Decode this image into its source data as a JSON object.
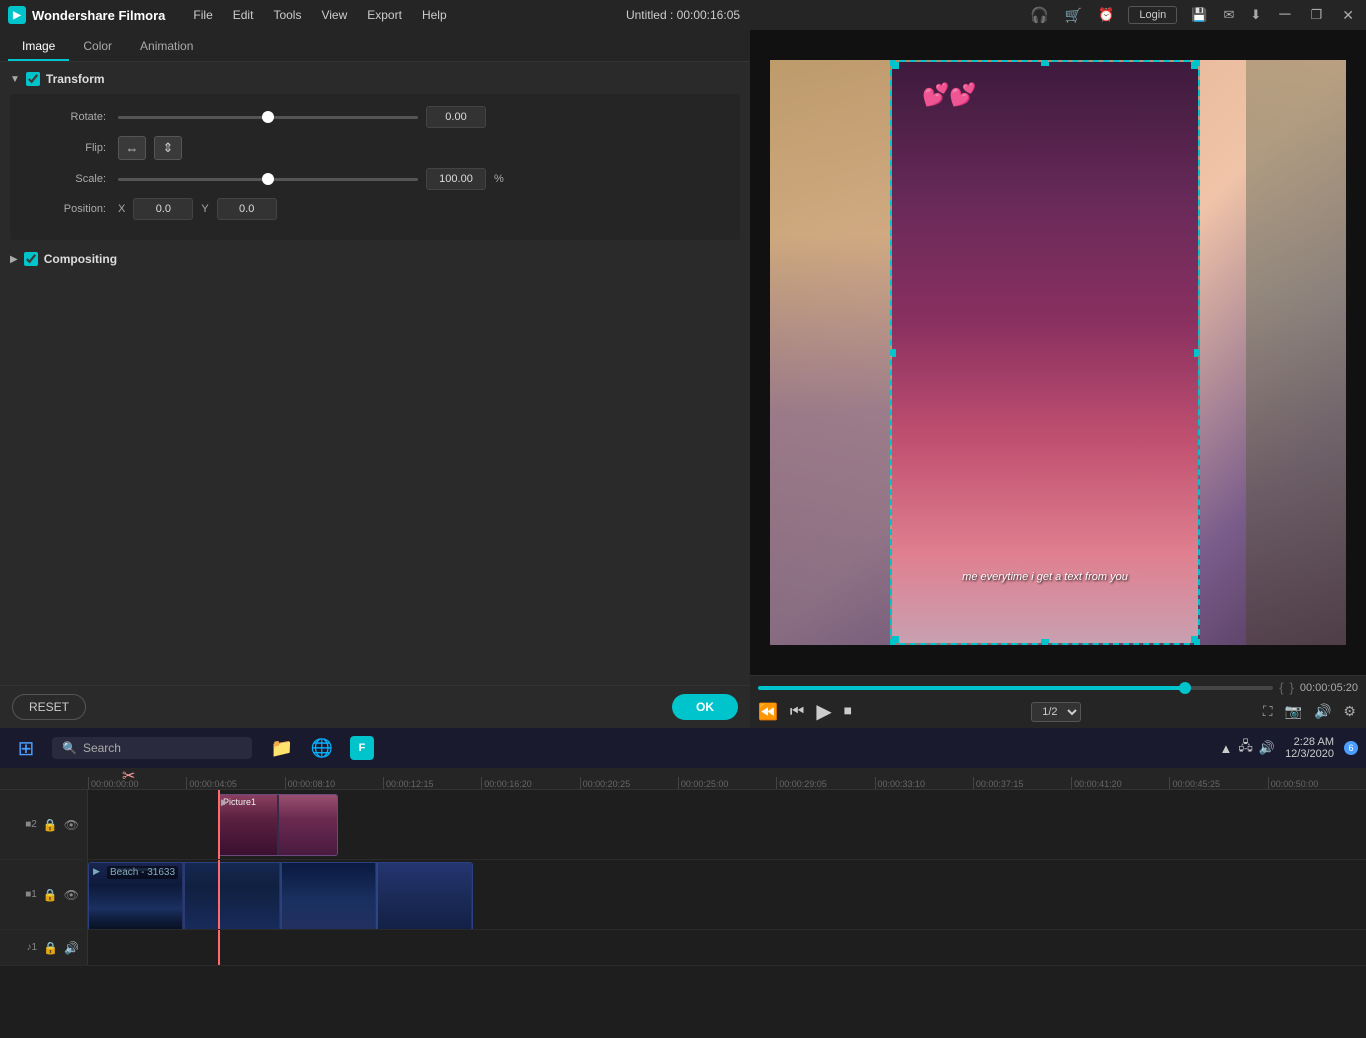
{
  "app": {
    "name": "Wondershare Filmora",
    "title": "Untitled : 00:00:16:05"
  },
  "menu": {
    "items": [
      "File",
      "Edit",
      "Tools",
      "View",
      "Export",
      "Help"
    ]
  },
  "tabs": {
    "items": [
      "Image",
      "Color",
      "Animation"
    ],
    "active": "Image"
  },
  "transform": {
    "title": "Transform",
    "rotate_label": "Rotate:",
    "rotate_value": "0.00",
    "flip_label": "Flip:",
    "scale_label": "Scale:",
    "scale_value": "100.00",
    "scale_unit": "%",
    "position_label": "Position:",
    "position_x_label": "X",
    "position_x_value": "0.0",
    "position_y_label": "Y",
    "position_y_value": "0.0"
  },
  "compositing": {
    "title": "Compositing"
  },
  "buttons": {
    "reset": "RESET",
    "ok": "OK"
  },
  "preview": {
    "timecode": "00:00:05:20",
    "brackets_left": "{",
    "brackets_right": "}",
    "quality": "1/2",
    "text": "me everytime i get\na text from you"
  },
  "timeline": {
    "ruler_marks": [
      "00:00:00:00",
      "00:00:04:05",
      "00:00:08:10",
      "00:00:12:15",
      "00:00:16:20",
      "00:00:20:25",
      "00:00:25:00",
      "00:00:29:05",
      "00:00:33:10",
      "00:00:37:15",
      "00:00:41:20",
      "00:00:45:25",
      "00:00:50:00"
    ],
    "track1": {
      "label": "2",
      "clip_label": "Picture1"
    },
    "track2": {
      "label": "1",
      "clip_label": "Beach - 31633"
    },
    "track3": {
      "label": "1"
    }
  },
  "taskbar": {
    "search_placeholder": "Search",
    "time": "2:28 AM",
    "date": "12/3/2020",
    "notification_count": "6"
  }
}
